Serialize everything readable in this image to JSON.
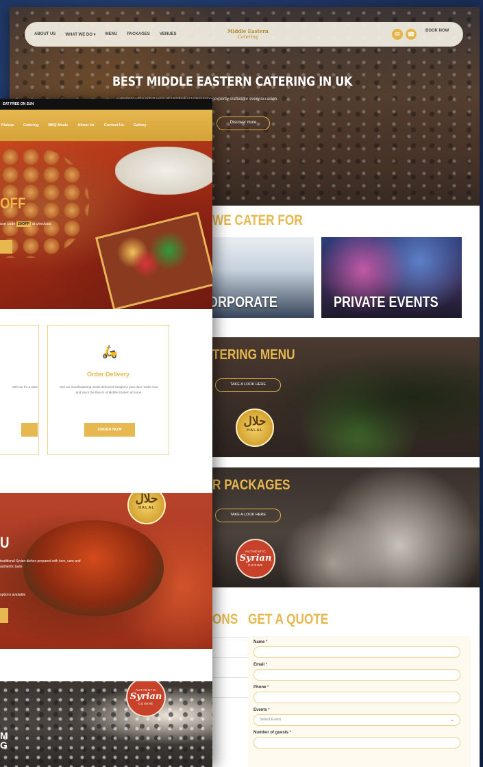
{
  "back_site": {
    "nav": {
      "links": [
        "ABOUT US",
        "WHAT WE DO ▾",
        "MENU",
        "PACKAGES",
        "VENUES"
      ],
      "logo_line1": "Middle Eastern",
      "logo_line2": "Catering",
      "icon_email": "email-icon",
      "icon_phone": "phone-icon",
      "book_now": "BOOK NOW"
    },
    "hero": {
      "title": "BEST MIDDLE EASTERN CATERING IN UK",
      "subtitle": "Experience the rich flavors of Middle Eastern cuisine, expertly crafted for every occasion.",
      "button": "Discover more"
    },
    "cater": {
      "title": "WE CATER FOR",
      "tiles": [
        "ORPORATE",
        "PRIVATE EVENTS"
      ]
    },
    "menu_band": {
      "title": "TERING MENU",
      "button": "TAKE A LOOK HERE",
      "halal_ar": "حلال",
      "halal_en": "HALAL"
    },
    "packages_band": {
      "title": "R PACKAGES",
      "button": "TAKE A LOOK HERE",
      "badge_top": "AUTHENTIC",
      "badge_main": "Syrian",
      "badge_bottom": "CUISINE"
    },
    "quote": {
      "left_partial": "ONS",
      "title": "GET A QUOTE",
      "side_items": [
        "",
        "",
        "",
        ""
      ],
      "fields": [
        {
          "label": "Name",
          "required": "*",
          "value": ""
        },
        {
          "label": "Email",
          "required": "*",
          "value": ""
        },
        {
          "label": "Phone",
          "required": "*",
          "value": ""
        },
        {
          "label": "Events",
          "required": "*",
          "value": "Select Event"
        },
        {
          "label": "Number of guests",
          "required": "*",
          "value": ""
        }
      ]
    }
  },
  "front_site": {
    "topbar": "EAT FREE ON SUN",
    "nav": [
      "Pickup",
      "Catering",
      "BBQ Meals",
      "About Us",
      "Contact Us",
      "Gallery"
    ],
    "hero": {
      "off_text": "OFF",
      "offer_prefix": "use code",
      "offer_code": "20OFF",
      "offer_suffix": "at checkout"
    },
    "cards": [
      {
        "title": "",
        "desc": "with our for a taste",
        "button": ""
      },
      {
        "title": "Order Delivery",
        "desc": "Get our mouthwatering meals delivered straight to your door. Order now and savor the flavors of Middle Eastern at home.",
        "button": "ORDER NOW",
        "icon": "delivery-scooter-icon"
      }
    ],
    "menu_band": {
      "title": "U",
      "desc": "traditional Syrian dishes prepared with love, care and authentic taste",
      "desc2": "options available",
      "halal_ar": "حلال",
      "halal_en": "HALAL"
    },
    "events_band": {
      "text1": "M",
      "text2": "G",
      "badge_top": "AUTHENTIC",
      "badge_main": "Syrian",
      "badge_bottom": "CUISINE"
    }
  }
}
